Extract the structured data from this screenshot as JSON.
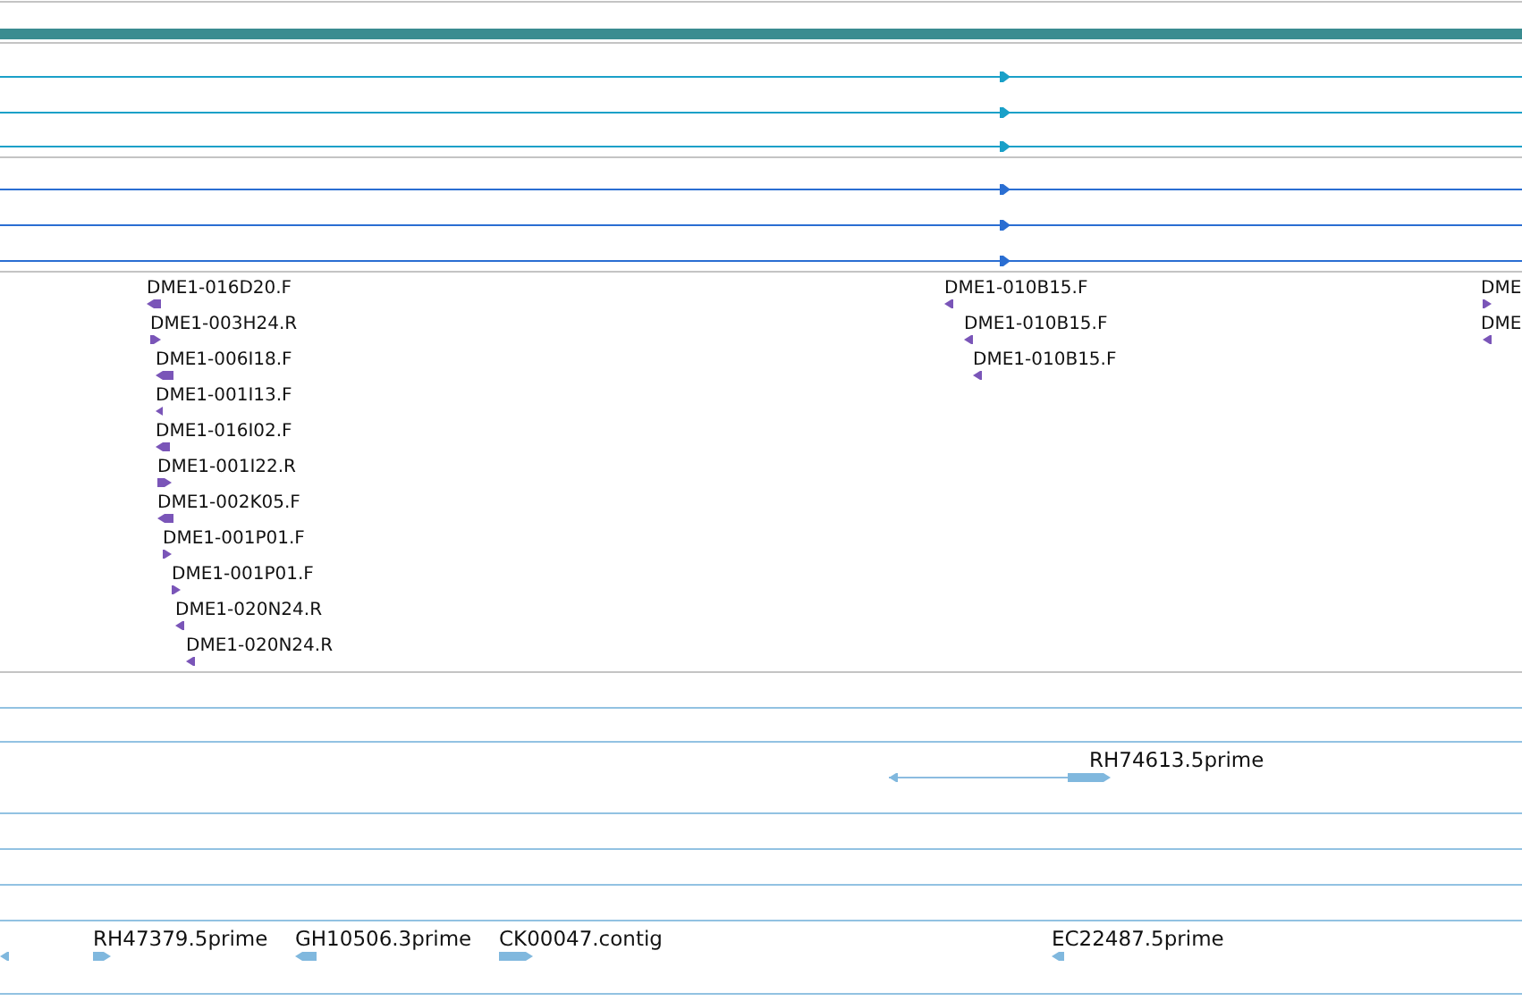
{
  "transcripts": [
    {
      "forward": true,
      "color": "#1aa0c8"
    },
    {
      "forward": true,
      "color": "#1aa0c8"
    },
    {
      "forward": true,
      "color": "#1aa0c8"
    },
    {
      "forward": true,
      "color": "#2a6ed2"
    },
    {
      "forward": true,
      "color": "#2a6ed2"
    },
    {
      "forward": true,
      "color": "#2a6ed2"
    }
  ],
  "clone_ends": [
    {
      "label": "DME1-016D20.F",
      "forward": false
    },
    {
      "label": "DME1-003H24.R",
      "forward": true
    },
    {
      "label": "DME1-006I18.F",
      "forward": false
    },
    {
      "label": "DME1-001I13.F",
      "forward": false
    },
    {
      "label": "DME1-016I02.F",
      "forward": false
    },
    {
      "label": "DME1-001I22.R",
      "forward": true
    },
    {
      "label": "DME1-002K05.F",
      "forward": false
    },
    {
      "label": "DME1-001P01.F",
      "forward": true
    },
    {
      "label": "DME1-001P01.F",
      "forward": true
    },
    {
      "label": "DME1-020N24.R",
      "forward": false
    },
    {
      "label": "DME1-020N24.R",
      "forward": false
    },
    {
      "label": "DME1-010B15.F",
      "forward": false
    },
    {
      "label": "DME1-010B15.F",
      "forward": false
    },
    {
      "label": "DME1-010B15.F",
      "forward": false
    },
    {
      "label": "DME",
      "forward": true
    },
    {
      "label": "DME",
      "forward": false
    }
  ],
  "est_features": [
    {
      "forward": false
    },
    {
      "label": "RH74613.5prime",
      "forward": true
    },
    {
      "forward": false
    },
    {
      "label": "RH47379.5prime",
      "forward": true
    },
    {
      "label": "GH10506.3prime",
      "forward": false
    },
    {
      "label": "CK00047.contig",
      "forward": true
    },
    {
      "label": "EC22487.5prime",
      "forward": false
    }
  ]
}
